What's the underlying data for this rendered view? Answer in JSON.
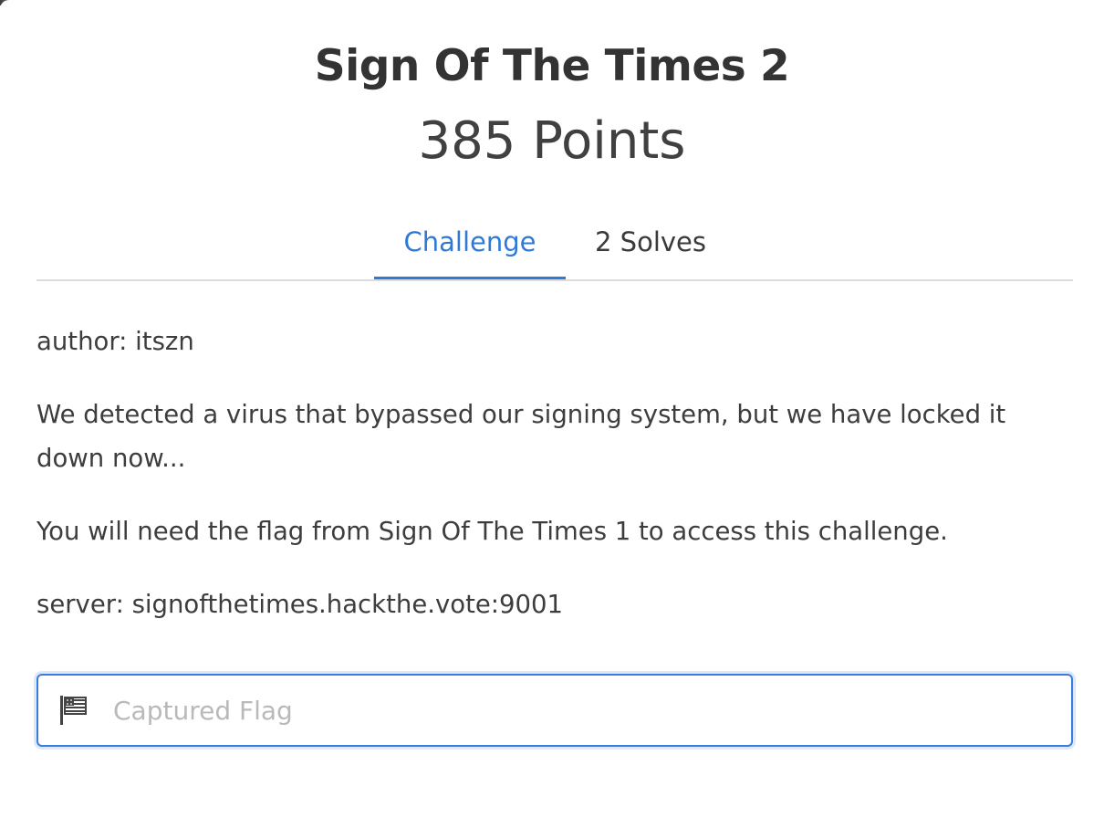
{
  "modal": {
    "title": "Sign Of The Times 2",
    "points": "385 Points"
  },
  "tabs": [
    {
      "label": "Challenge",
      "active": true
    },
    {
      "label": "2 Solves",
      "active": false
    }
  ],
  "description": {
    "author": "author: itszn",
    "paragraph1": "We detected a virus that bypassed our signing system, but we have locked it down now...",
    "paragraph2": "You will need the flag from Sign Of The Times 1 to access this challenge.",
    "server": "server: signofthetimes.hackthe.vote:9001"
  },
  "flag_input": {
    "placeholder": "Captured Flag",
    "value": "",
    "icon": "flag-icon"
  },
  "colors": {
    "accent": "#2f7ad6",
    "text": "#3a3a3a",
    "divider": "#dcdcdc"
  }
}
